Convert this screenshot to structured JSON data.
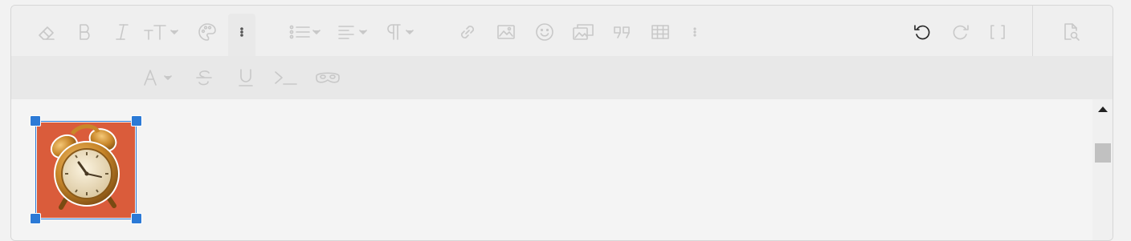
{
  "toolbar": {
    "row1": [
      {
        "name": "clear-format-button",
        "icon": "eraser-icon"
      },
      {
        "name": "bold-button",
        "icon": "bold-icon",
        "label": "B"
      },
      {
        "name": "italic-button",
        "icon": "italic-icon",
        "label": "I"
      },
      {
        "name": "font-size-button",
        "icon": "text-size-icon"
      },
      {
        "name": "color-button",
        "icon": "palette-icon"
      },
      {
        "name": "more-text-button",
        "icon": "more-vertical-icon"
      },
      {
        "name": "list-button",
        "icon": "list-icon"
      },
      {
        "name": "align-button",
        "icon": "align-icon"
      },
      {
        "name": "paragraph-button",
        "icon": "paragraph-icon",
        "label": "¶"
      },
      {
        "name": "link-button",
        "icon": "link-icon"
      },
      {
        "name": "insert-image-button",
        "icon": "image-icon"
      },
      {
        "name": "emoji-button",
        "icon": "smiley-icon"
      },
      {
        "name": "media-button",
        "icon": "gallery-icon"
      },
      {
        "name": "quote-button",
        "icon": "quote-icon"
      },
      {
        "name": "table-button",
        "icon": "table-icon"
      },
      {
        "name": "more-insert-button",
        "icon": "more-vertical-icon"
      },
      {
        "name": "undo-button",
        "icon": "undo-icon",
        "active": true
      },
      {
        "name": "redo-button",
        "icon": "redo-icon"
      },
      {
        "name": "toggle-bbcode-button",
        "icon": "brackets-icon"
      },
      {
        "name": "preview-button",
        "icon": "preview-icon"
      }
    ],
    "row2": [
      {
        "name": "font-family-button",
        "icon": "font-icon",
        "label": "A"
      },
      {
        "name": "strikethrough-button",
        "icon": "strikethrough-icon"
      },
      {
        "name": "underline-button",
        "icon": "underline-icon"
      },
      {
        "name": "inline-code-button",
        "icon": "terminal-icon"
      },
      {
        "name": "spoiler-button",
        "icon": "mask-icon"
      }
    ]
  },
  "content": {
    "image": {
      "name": "alarm-clock-image",
      "background": "#da5c3b"
    }
  },
  "colors": {
    "selection": "#2c7ad6",
    "icon_disabled": "#c8c8c8",
    "icon_active": "#222222"
  }
}
